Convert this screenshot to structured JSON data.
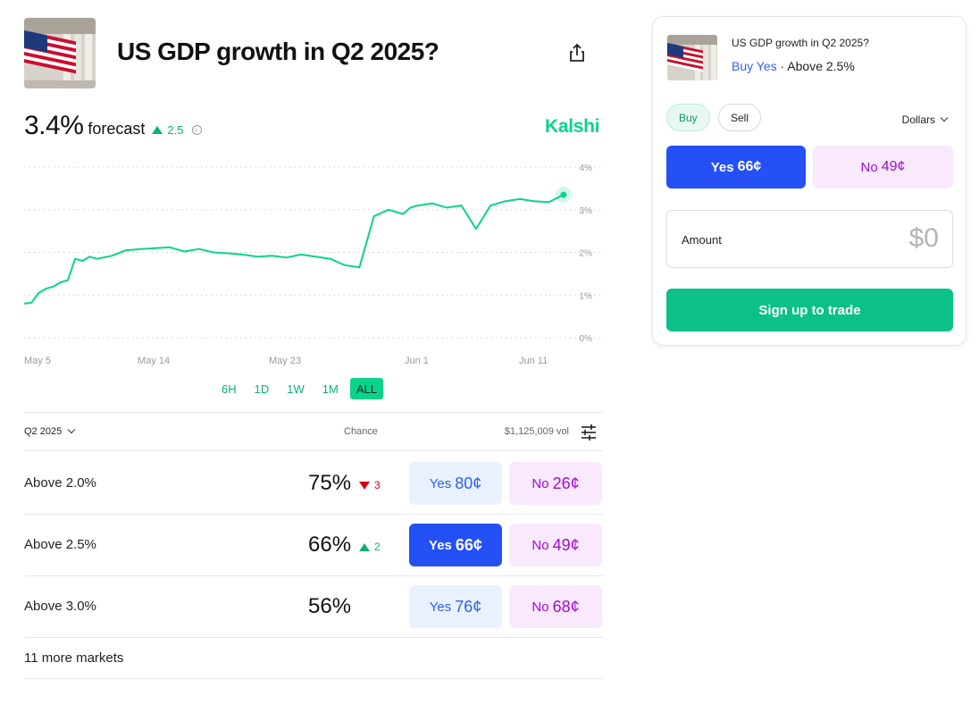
{
  "market": {
    "title": "US GDP growth in Q2 2025?",
    "forecast_value": "3.4%",
    "forecast_label": "forecast",
    "forecast_change": "2.5",
    "brand": "Kalshi",
    "thumbnail_icon": "us-flag-building-image",
    "share_icon": "share-icon"
  },
  "chart_data": {
    "type": "line",
    "y_tick_labels": [
      "4%",
      "3%",
      "2%",
      "1%",
      "0%"
    ],
    "x_tick_labels": [
      "May 5",
      "May 14",
      "May 23",
      "Jun 1",
      "Jun 11"
    ],
    "ylim": [
      0,
      4
    ],
    "grid": true,
    "line_color": "#0bd38a",
    "series": [
      {
        "x": [
          "May 5",
          "May 5",
          "May 6",
          "May 6",
          "May 7",
          "May 7",
          "May 8",
          "May 8",
          "May 9",
          "May 9",
          "May 10",
          "May 11",
          "May 12",
          "May 13",
          "May 14",
          "May 15",
          "May 16",
          "May 17",
          "May 18",
          "May 19",
          "May 20",
          "May 21",
          "May 22",
          "May 23",
          "May 24",
          "May 25",
          "May 26",
          "May 27",
          "May 28",
          "May 29",
          "May 30",
          "May 31",
          "May 31",
          "Jun 1",
          "Jun 2",
          "Jun 3",
          "Jun 4",
          "Jun 5",
          "Jun 6",
          "Jun 6",
          "Jun 7",
          "Jun 8",
          "Jun 9",
          "Jun 10",
          "Jun 11"
        ],
        "y": [
          0.8,
          0.82,
          1.05,
          1.15,
          1.2,
          1.3,
          1.35,
          1.85,
          1.8,
          1.9,
          1.85,
          1.92,
          2.05,
          2.08,
          2.1,
          2.12,
          2.02,
          2.08,
          2.0,
          1.98,
          1.95,
          1.9,
          1.92,
          1.88,
          1.95,
          1.9,
          1.85,
          1.7,
          1.65,
          2.85,
          3.0,
          2.9,
          3.05,
          3.1,
          3.15,
          3.05,
          3.1,
          2.55,
          3.1,
          3.15,
          3.2,
          3.25,
          3.2,
          3.18,
          3.35
        ]
      }
    ]
  },
  "range_tabs": [
    "6H",
    "1D",
    "1W",
    "1M",
    "ALL"
  ],
  "range_active": "ALL",
  "table": {
    "period": "Q2 2025",
    "chance_header": "Chance",
    "volume": "$1,125,009 vol",
    "rows": [
      {
        "label": "Above 2.0%",
        "chance": "75%",
        "change": "3",
        "direction": "down",
        "yes_label": "Yes",
        "yes_price": "80¢",
        "no_label": "No",
        "no_price": "26¢",
        "selected": false
      },
      {
        "label": "Above 2.5%",
        "chance": "66%",
        "change": "2",
        "direction": "up",
        "yes_label": "Yes",
        "yes_price": "66¢",
        "no_label": "No",
        "no_price": "49¢",
        "selected": true
      },
      {
        "label": "Above 3.0%",
        "chance": "56%",
        "change": "",
        "direction": "",
        "yes_label": "Yes",
        "yes_price": "76¢",
        "no_label": "No",
        "no_price": "68¢",
        "selected": false
      }
    ],
    "more_markets": "11 more markets"
  },
  "panel": {
    "title": "US GDP growth in Q2 2025?",
    "side": "Buy Yes",
    "separator": " · ",
    "selection": "Above 2.5%",
    "buy_label": "Buy",
    "sell_label": "Sell",
    "currency": "Dollars",
    "yes_label": "Yes",
    "yes_price": "66¢",
    "no_label": "No",
    "no_price": "49¢",
    "amount_label": "Amount",
    "amount_value": "$0",
    "cta": "Sign up to trade"
  },
  "colors": {
    "brand_green": "#0bd38a",
    "yes_blue": "#2450f5",
    "no_purple": "#a00cd4",
    "cta_green": "#0cc08a"
  }
}
